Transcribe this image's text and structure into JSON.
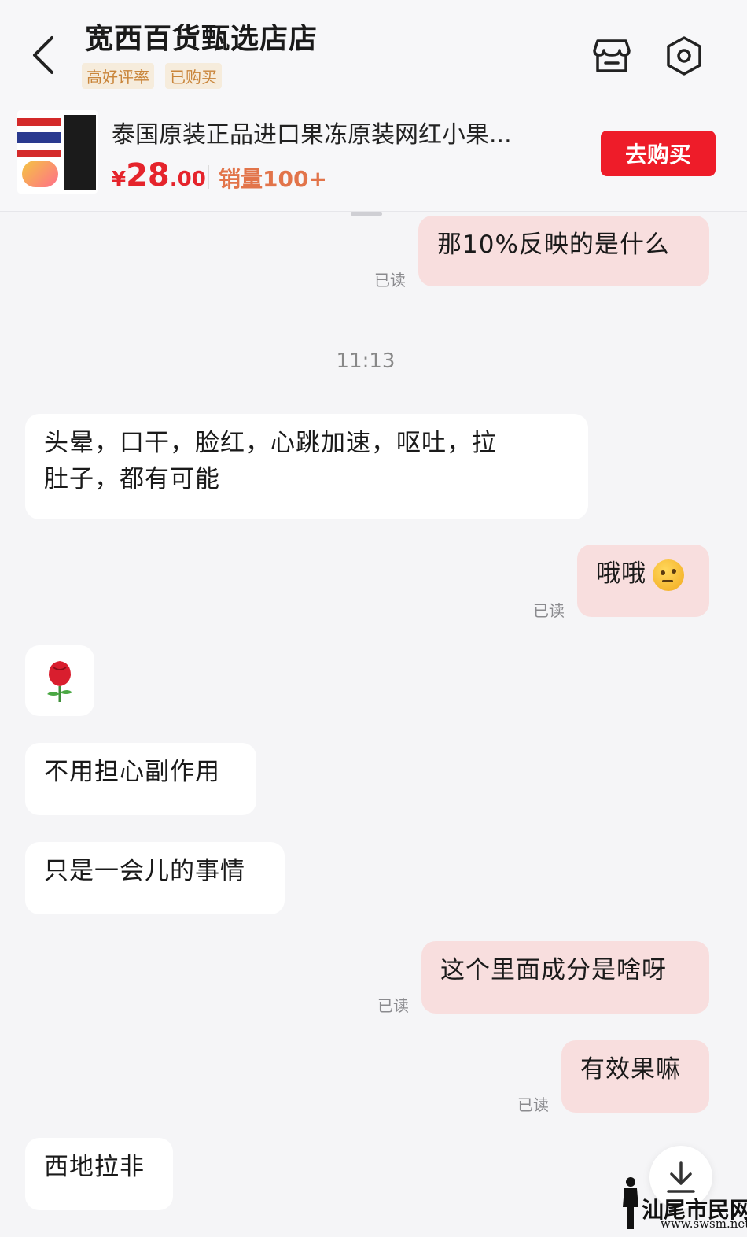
{
  "header": {
    "shop_name": "宽西百货甄选店店",
    "tags": [
      "高好评率",
      "已购买"
    ]
  },
  "product": {
    "title": "泰国原装正品进口果冻原装网红小果...",
    "price_currency": "¥",
    "price_int": "28",
    "price_dec": ".00",
    "sales": "销量100+",
    "buy_label": "去购买"
  },
  "messages": {
    "m1": "那10%反映的是什么",
    "time": "11:13",
    "m2_line1": "头晕，口干，脸红，心跳加速，呕吐，拉",
    "m2_line2": "肚子，都有可能",
    "m3": "哦哦",
    "m4": "不用担心副作用",
    "m5": "只是一会儿的事情",
    "m6": "这个里面成分是啥呀",
    "m7": "有效果嘛",
    "m8": "西地拉非",
    "read_label": "已读"
  },
  "watermark": {
    "text": "汕尾市民网",
    "url": "www.swsm.net"
  },
  "icons": {
    "back": "back-chevron-icon",
    "store": "store-icon",
    "settings": "settings-hexagon-icon",
    "emoji": "thinking-face-icon",
    "rose": "rose-icon",
    "scroll": "download-arrow-icon"
  }
}
